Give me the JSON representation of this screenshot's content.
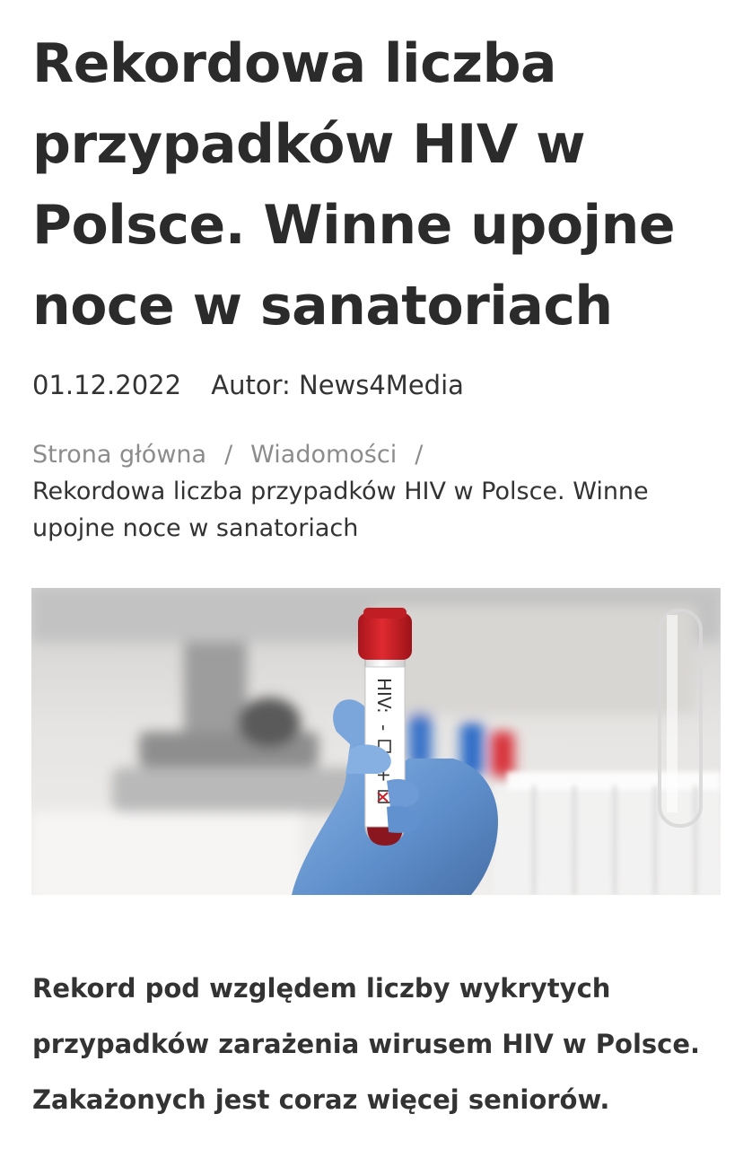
{
  "article": {
    "title": "Rekordowa liczba przypadków HIV w Polsce. Winne upojne noce w sanatoriach",
    "date": "01.12.2022",
    "author": "Autor: News4Media",
    "lead": "Rekord pod względem liczby wykrytych przypadków zarażenia wirusem HIV w Polsce. Zakażonych jest coraz więcej seniorów."
  },
  "breadcrumb": {
    "home": "Strona główna",
    "separator": "/",
    "section": "Wiadomości",
    "current": "Rekordowa liczba przypadków HIV w Polsce. Winne upojne noce w sanatoriach"
  },
  "hero_image": {
    "tube_label_text": "HIV:",
    "tube_minus": "-",
    "tube_plus": "+",
    "colors": {
      "cap": "#d2232a",
      "glove": "#6f9fd6",
      "blood": "#8a1620",
      "background": "#ece9e6"
    }
  }
}
